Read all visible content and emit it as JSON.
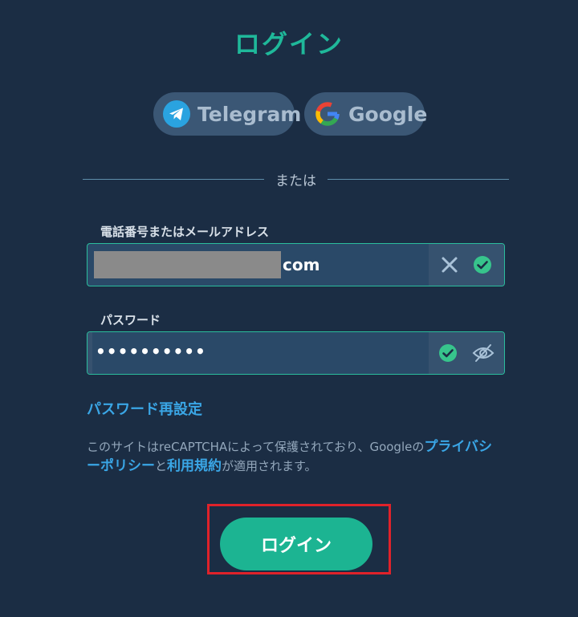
{
  "title": "ログイン",
  "social": {
    "telegram_label": "Telegram",
    "google_label": "Google"
  },
  "divider_text": "または",
  "email_field": {
    "label": "電話番号またはメールアドレス",
    "value_visible_suffix": "com",
    "clear_icon": "close-icon",
    "valid_icon": "check-circle-icon"
  },
  "password_field": {
    "label": "パスワード",
    "value_masked": "••••••••••",
    "valid_icon": "check-circle-icon",
    "toggle_icon": "eye-slash-icon"
  },
  "reset_link": "パスワード再設定",
  "notice": {
    "text_before": "このサイトはreCAPTCHAによって保護されており、Googleの",
    "privacy_link": "プライバシーポリシー",
    "text_mid": "と",
    "terms_link": "利用規約",
    "text_after": "が適用されます。"
  },
  "submit_label": "ログイン",
  "colors": {
    "background": "#1b2d44",
    "accent": "#1fb89a",
    "link": "#3aa6e6",
    "highlight": "#e0222a"
  }
}
